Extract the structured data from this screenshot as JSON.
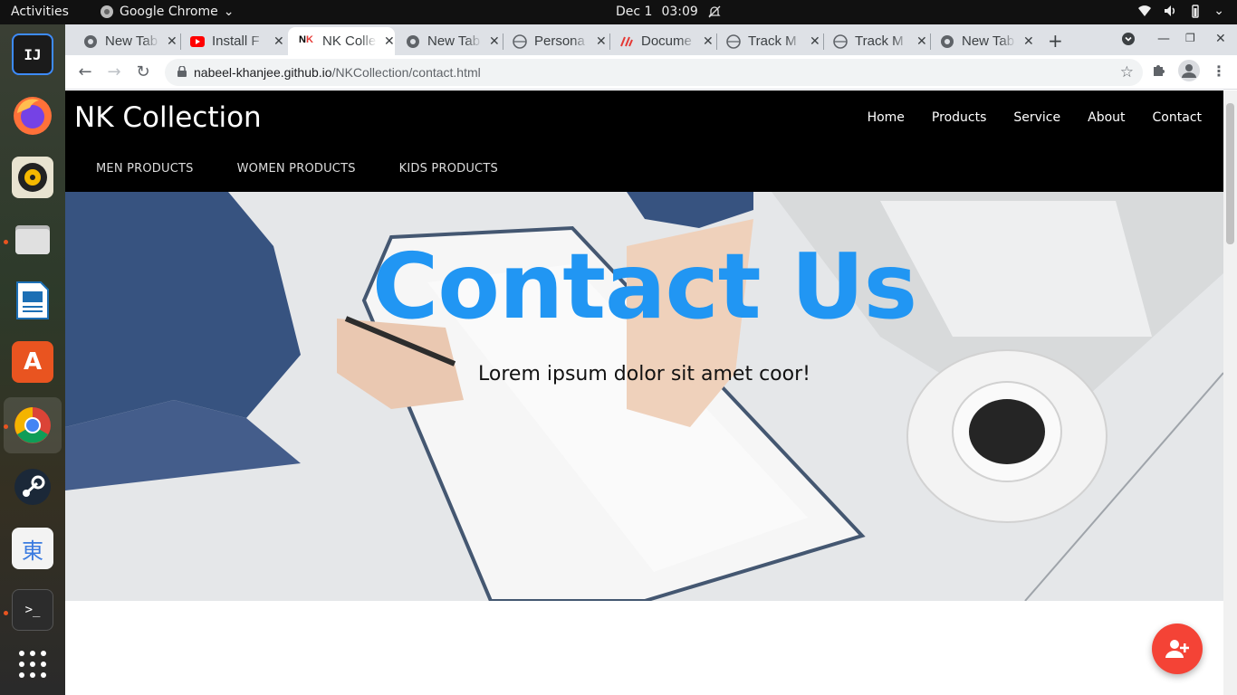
{
  "system": {
    "activities": "Activities",
    "app_name": "Google Chrome",
    "clock_date": "Dec 1",
    "clock_time": "03:09"
  },
  "dock": {
    "items": [
      {
        "name": "intellij-icon"
      },
      {
        "name": "firefox-icon"
      },
      {
        "name": "rhythmbox-icon"
      },
      {
        "name": "files-icon"
      },
      {
        "name": "libreoffice-writer-icon"
      },
      {
        "name": "ubuntu-software-icon"
      },
      {
        "name": "chrome-icon"
      },
      {
        "name": "steam-icon"
      },
      {
        "name": "mozc-icon",
        "glyph": "東"
      },
      {
        "name": "terminal-icon"
      },
      {
        "name": "show-apps-icon"
      }
    ]
  },
  "browser": {
    "tabs": [
      {
        "title": "New Tab",
        "icon": "chrome-globe-icon"
      },
      {
        "title": "Install F",
        "icon": "youtube-icon"
      },
      {
        "title": "NK Colle",
        "icon": "nk-logo-icon",
        "active": true
      },
      {
        "title": "New Tab",
        "icon": "chrome-globe-icon"
      },
      {
        "title": "Persona",
        "icon": "globe-icon"
      },
      {
        "title": "Docume",
        "icon": "docs-icon"
      },
      {
        "title": "Track M",
        "icon": "globe-icon"
      },
      {
        "title": "Track M",
        "icon": "globe-icon"
      },
      {
        "title": "New Tab",
        "icon": "chrome-globe-icon"
      }
    ],
    "url_host": "nabeel-khanjee.github.io",
    "url_path": "/NKCollection/contact.html"
  },
  "site": {
    "brand": "NK Collection",
    "nav": [
      "Home",
      "Products",
      "Service",
      "About",
      "Contact"
    ],
    "subnav": [
      "MEN PRODUCTS",
      "WOMEN PRODUCTS",
      "KIDS PRODUCTS"
    ],
    "hero_title": "Contact Us",
    "hero_subtitle": "Lorem ipsum dolor sit amet coor!",
    "accent_color": "#2196f3",
    "fab_color": "#f44336"
  }
}
